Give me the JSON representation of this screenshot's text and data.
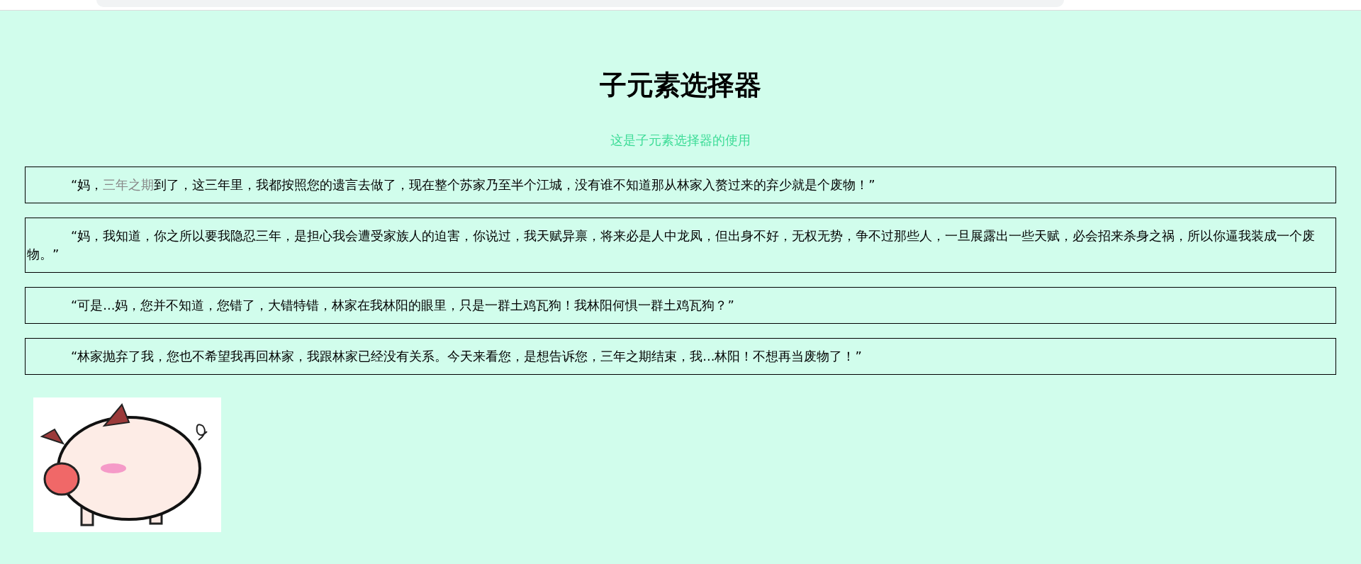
{
  "title": "子元素选择器",
  "subtitle": "这是子元素选择器的使用",
  "paragraphs": [
    {
      "segments": [
        {
          "kind": "plain",
          "text": "“妈，"
        },
        {
          "kind": "muted",
          "text": "三年之期"
        },
        {
          "kind": "plain",
          "text": "到了，这三年里，我都按照您的遗言去做了，现在整个苏家乃至半个江城，没有谁不知道那从林家入赘过来的弃少就是个废物！”"
        }
      ]
    },
    {
      "segments": [
        {
          "kind": "plain",
          "text": "“妈，我知道，你之所以要我隐忍三年，是担心我会遭受家族人的迫害，你说过，我天赋异禀，将来必是人中龙凤，但出身不好，无权无势，争不过那些人，一旦展露出一些天赋，必会招来杀身之祸，所以你逼我装成一个废物。”"
        }
      ]
    },
    {
      "segments": [
        {
          "kind": "plain",
          "text": "“可是...妈，您并不知道，您错了，大错特错，林家在我林阳的眼里，只是一群土鸡瓦狗！我林阳何惧一群土鸡瓦狗？”"
        }
      ]
    },
    {
      "segments": [
        {
          "kind": "plain",
          "text": "“林家抛弃了我，您也不希望我再回林家，我跟林家已经没有关系。今天来看您，是想告诉您，三年之期结束，我...林阳！不想再当废物了！”"
        }
      ]
    }
  ]
}
